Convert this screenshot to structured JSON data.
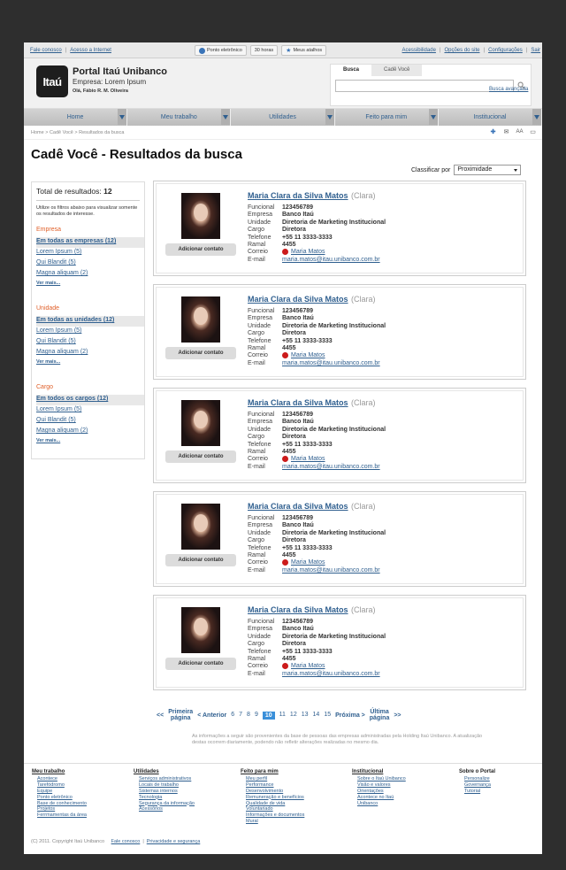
{
  "topbar": {
    "left_links": [
      "Fale conosco",
      "Acesso a Internet"
    ],
    "buttons": [
      "Ponto eletrônico",
      "30 horas",
      "Meus atalhos"
    ],
    "right_links": [
      "Acessibilidade",
      "Opções do site",
      "Configurações",
      "Sair"
    ]
  },
  "header": {
    "logo_text": "Itaú",
    "portal_title": "Portal Itaú Unibanco",
    "company": "Empresa: Lorem Ipsum",
    "greeting": "Olá, Fábio R. M. Oliveira",
    "search_tabs": [
      "Busca",
      "Cadê Você"
    ],
    "search_value": "",
    "advanced_search": "Busca avançada"
  },
  "nav": [
    "Home",
    "Meu trabalho",
    "Utilidades",
    "Feito para mim",
    "Institucional"
  ],
  "breadcrumb": "Home > Cadê Você > Resultados da busca",
  "tools": [
    "add-icon",
    "mail-icon",
    "font-size-icon",
    "chat-icon"
  ],
  "tools_text": {
    "font": "AA"
  },
  "page_title": "Cadê Você - Resultados da busca",
  "sort": {
    "label": "Classificar por",
    "selected": "Proximidade"
  },
  "filters": {
    "total_label": "Total de resultados:",
    "total": "12",
    "hint": "Utilize os filtros abaixo para visualizar somente os resultados de interesse.",
    "groups": [
      {
        "title": "Empresa",
        "options": [
          {
            "label": "Em todas as empresas",
            "count": "(12)"
          },
          {
            "label": "Lorem Ipsum",
            "count": "(5)"
          },
          {
            "label": "Qui Blandit",
            "count": "(5)"
          },
          {
            "label": "Magna aliquam",
            "count": "(2)"
          }
        ],
        "more": "Ver mais..."
      },
      {
        "title": "Unidade",
        "options": [
          {
            "label": "Em todas as unidades",
            "count": "(12)"
          },
          {
            "label": "Lorem Ipsum",
            "count": "(5)"
          },
          {
            "label": "Qui Blandit",
            "count": "(5)"
          },
          {
            "label": "Magna aliquam",
            "count": "(2)"
          }
        ],
        "more": "Ver mais..."
      },
      {
        "title": "Cargo",
        "options": [
          {
            "label": "Em todos os cargos",
            "count": "(12)"
          },
          {
            "label": "Lorem Ipsum",
            "count": "(5)"
          },
          {
            "label": "Qui Blandit",
            "count": "(5)"
          },
          {
            "label": "Magna aliquam",
            "count": "(2)"
          }
        ],
        "more": "Ver mais..."
      }
    ]
  },
  "result_labels": [
    "Funcional",
    "Empresa",
    "Unidade",
    "Cargo",
    "Telefone",
    "Ramal",
    "Correio",
    "E-mail"
  ],
  "results": [
    {
      "name": "Maria Clara da Silva Matos",
      "nick": "(Clara)",
      "funcional": "123456789",
      "empresa": "Banco Itaú",
      "unidade": "Diretoria de Marketing Institucional",
      "cargo": "Diretora",
      "telefone": "+55 11 3333-3333",
      "ramal": "4455",
      "correio": "Maria Matos",
      "email": "maria.matos@itau.unibanco.com.br",
      "add_label": "Adicionar contato"
    },
    {
      "name": "Maria Clara da Silva Matos",
      "nick": "(Clara)",
      "funcional": "123456789",
      "empresa": "Banco Itaú",
      "unidade": "Diretoria de Marketing Institucional",
      "cargo": "Diretora",
      "telefone": "+55 11 3333-3333",
      "ramal": "4455",
      "correio": "Maria Matos",
      "email": "maria.matos@itau.unibanco.com.br",
      "add_label": "Adicionar contato"
    },
    {
      "name": "Maria Clara da Silva Matos",
      "nick": "(Clara)",
      "funcional": "123456789",
      "empresa": "Banco Itaú",
      "unidade": "Diretoria de Marketing Institucional",
      "cargo": "Diretora",
      "telefone": "+55 11 3333-3333",
      "ramal": "4455",
      "correio": "Maria Matos",
      "email": "maria.matos@itau.unibanco.com.br",
      "add_label": "Adicionar contato"
    },
    {
      "name": "Maria Clara da Silva Matos",
      "nick": "(Clara)",
      "funcional": "123456789",
      "empresa": "Banco Itaú",
      "unidade": "Diretoria de Marketing Institucional",
      "cargo": "Diretora",
      "telefone": "+55 11 3333-3333",
      "ramal": "4455",
      "correio": "Maria Matos",
      "email": "maria.matos@itau.unibanco.com.br",
      "add_label": "Adicionar contato"
    },
    {
      "name": "Maria Clara da Silva Matos",
      "nick": "(Clara)",
      "funcional": "123456789",
      "empresa": "Banco Itaú",
      "unidade": "Diretoria de Marketing Institucional",
      "cargo": "Diretora",
      "telefone": "+55 11 3333-3333",
      "ramal": "4455",
      "correio": "Maria Matos",
      "email": "maria.matos@itau.unibanco.com.br",
      "add_label": "Adicionar contato"
    }
  ],
  "pagination": {
    "first_a": "<<",
    "first_b": "Primeira",
    "first_c": "página",
    "prev": "< Anterior",
    "pages": [
      "6",
      "7",
      "8",
      "9",
      "10",
      "11",
      "12",
      "13",
      "14",
      "15"
    ],
    "current": "10",
    "next": "Próxima >",
    "last_a": "Última",
    "last_b": "página",
    "last_c": ">>"
  },
  "disclaimer": "As informações a seguir são provenientes da base de pessoas das empresas administradas pela Holding Itaú Unibanco. A atualização destas ocorrem diariamente, podendo não refletir alterações realizadas no mesmo dia.",
  "footer": {
    "columns": [
      {
        "title": "Meu trabalho",
        "links": [
          "Acontece",
          "Tarefódromo",
          "Equipe",
          "Ponto eletrônico",
          "Base de conhecimento",
          "Projetos",
          "Ferrmamentas da área"
        ]
      },
      {
        "title": "Utilidades",
        "links": [
          "Serviços administrativos",
          "Locais de trabalho",
          "Sistemas internos",
          "Tecnologia",
          "Segurança da informação",
          "Acessórios"
        ]
      },
      {
        "title": "Feito para mim",
        "links": [
          "Meu perfil",
          "Performance",
          "Desenvolvimento",
          "Remuneração e benefícios",
          "Qualidade de vida",
          "Voluntariado",
          "Informações e documentos",
          "Mural"
        ]
      },
      {
        "title": "Institucional",
        "links": [
          "Sobre o Itaú Unibanco",
          "Visão e valores",
          "Orientações",
          "Acontece no Itaú",
          "Unibanco"
        ]
      },
      {
        "title": "Sobre o Portal",
        "links": [
          "Personalize",
          "Governança",
          "Tutorial"
        ]
      }
    ],
    "copyright": "(C) 2011. Copyright Itaú Unibanco",
    "links": [
      "Fale conosco",
      "Privacidade e segurança"
    ]
  },
  "colors": {
    "accent_link": "#2f5f8f",
    "filter_title": "#e0602a",
    "status_dot": "#cc1b1b",
    "current_page": "#3a8fd9"
  }
}
